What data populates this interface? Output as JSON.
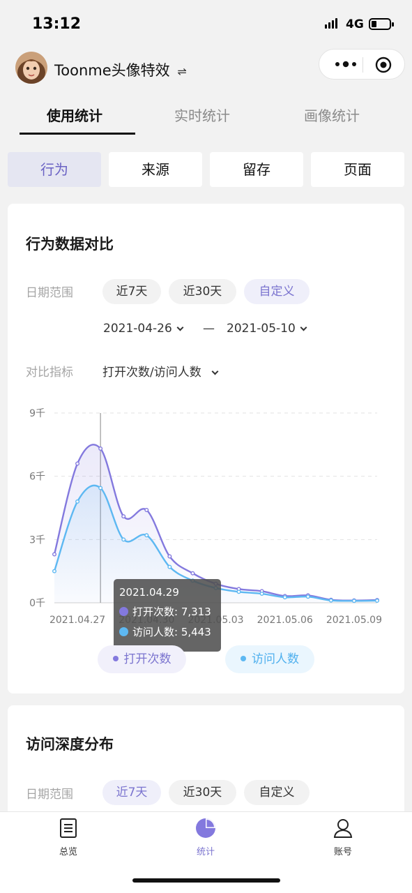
{
  "status": {
    "time": "13:12",
    "network": "4G"
  },
  "app": {
    "name": "Toonme头像特效",
    "switch_glyph": "⇌"
  },
  "top_tabs": [
    {
      "label": "使用统计",
      "active": true
    },
    {
      "label": "实时统计",
      "active": false
    },
    {
      "label": "画像统计",
      "active": false
    }
  ],
  "sub_tabs": [
    {
      "label": "行为",
      "active": true
    },
    {
      "label": "来源",
      "active": false
    },
    {
      "label": "留存",
      "active": false
    },
    {
      "label": "页面",
      "active": false
    }
  ],
  "behavior_card": {
    "title": "行为数据对比",
    "date_range_label": "日期范围",
    "range_options": [
      {
        "label": "近7天",
        "active": false
      },
      {
        "label": "近30天",
        "active": false
      },
      {
        "label": "自定义",
        "active": true
      }
    ],
    "start_date": "2021-04-26",
    "date_sep": "—",
    "end_date": "2021-05-10",
    "metric_label": "对比指标",
    "metric_value": "打开次数/访问人数",
    "tooltip": {
      "date": "2021.04.29",
      "series1": "打开次数: 7,313",
      "series2": "访问人数: 5,443"
    },
    "legend": [
      {
        "label": "打开次数",
        "color": "#8379de"
      },
      {
        "label": "访问人数",
        "color": "#5db8f2"
      }
    ]
  },
  "depth_card": {
    "title": "访问深度分布",
    "date_range_label": "日期范围",
    "range_options": [
      {
        "label": "近7天",
        "active": true
      },
      {
        "label": "近30天",
        "active": false
      },
      {
        "label": "自定义",
        "active": false
      }
    ]
  },
  "tabbar": [
    {
      "label": "总览",
      "icon": "document-icon",
      "active": false
    },
    {
      "label": "统计",
      "icon": "pie-chart-icon",
      "active": true
    },
    {
      "label": "账号",
      "icon": "person-icon",
      "active": false
    }
  ],
  "colors": {
    "accent": "#7b74cf",
    "series1": "#8379de",
    "series2": "#5db8f2"
  },
  "chart_data": {
    "type": "area",
    "x": [
      "2021.04.26",
      "2021.04.27",
      "2021.04.28",
      "2021.04.29",
      "2021.04.30",
      "2021.05.01",
      "2021.05.02",
      "2021.05.03",
      "2021.05.04",
      "2021.05.05",
      "2021.05.06",
      "2021.05.07",
      "2021.05.08",
      "2021.05.09",
      "2021.05.10"
    ],
    "x_tick_labels": [
      "2021.04.27",
      "2021.04.30",
      "2021.05.03",
      "2021.05.06",
      "2021.05.09"
    ],
    "y_tick_labels": [
      "0千",
      "3千",
      "6千",
      "9千"
    ],
    "ylim": [
      0,
      9000
    ],
    "series": [
      {
        "name": "打开次数",
        "values": [
          2300,
          6600,
          7313,
          4100,
          4400,
          2200,
          1400,
          900,
          650,
          550,
          320,
          350,
          140,
          110,
          130
        ]
      },
      {
        "name": "访问人数",
        "values": [
          1500,
          4800,
          5443,
          3000,
          3200,
          1700,
          1050,
          700,
          520,
          430,
          260,
          290,
          110,
          90,
          100
        ]
      }
    ],
    "grid": true,
    "legend_position": "bottom",
    "highlight_index": 2
  }
}
